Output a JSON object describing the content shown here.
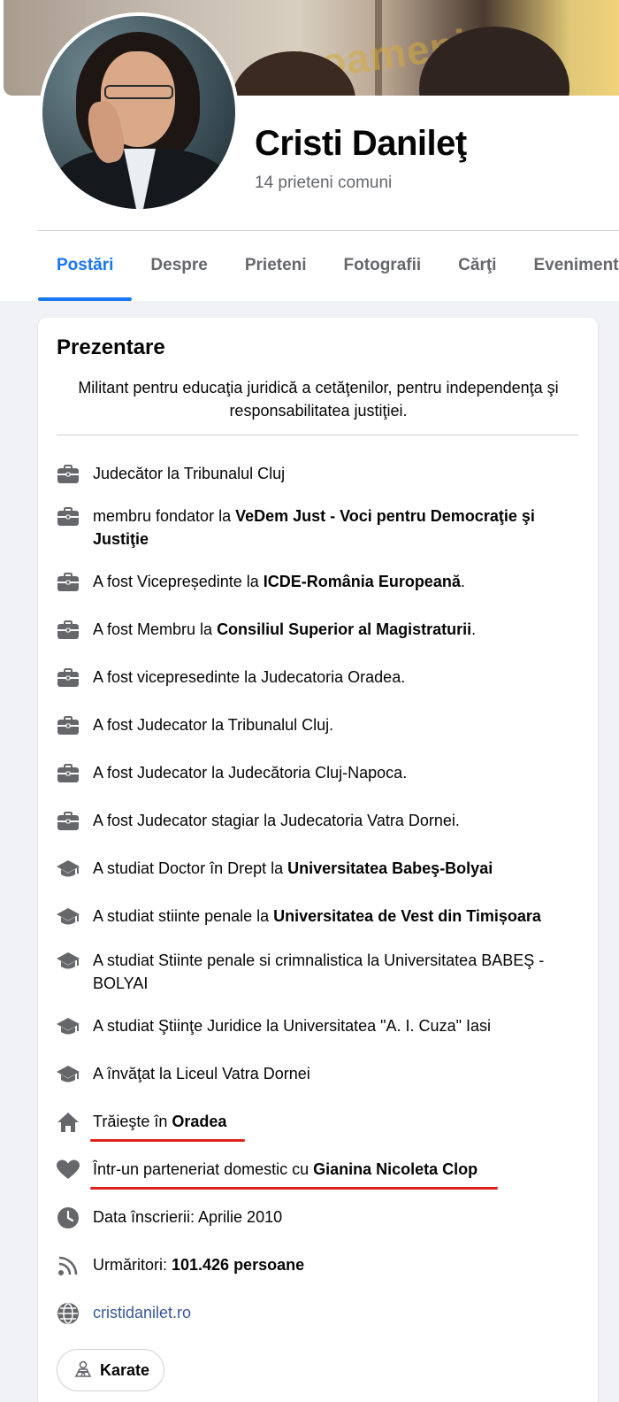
{
  "cover": {
    "banner_text": "ă oameni"
  },
  "profile": {
    "name": "Cristi Danileţ",
    "mutual_friends": "14 prieteni comuni"
  },
  "tabs": [
    {
      "label": "Postări"
    },
    {
      "label": "Despre"
    },
    {
      "label": "Prieteni"
    },
    {
      "label": "Fotografii"
    },
    {
      "label": "Cărţi"
    },
    {
      "label": "Evenimente"
    }
  ],
  "intro": {
    "title": "Prezentare",
    "bio": "Militant pentru educaţia juridică a cetăţenilor, pentru independenţa şi responsabilitatea justiţiei.",
    "items": [
      {
        "icon": "briefcase-icon",
        "pre": "Judecător la Tribunalul Cluj",
        "bold": "",
        "post": ""
      },
      {
        "icon": "briefcase-icon",
        "pre": "membru fondator la ",
        "bold": "VeDem Just - Voci pentru Democraţie şi Justiţie",
        "post": ""
      },
      {
        "icon": "briefcase-icon",
        "pre": "A fost Vicepreședinte la ",
        "bold": "ICDE-România Europeană",
        "post": "."
      },
      {
        "icon": "briefcase-icon",
        "pre": "A fost Membru la ",
        "bold": "Consiliul Superior al Magistraturii",
        "post": "."
      },
      {
        "icon": "briefcase-icon",
        "pre": "A fost vicepresedinte la Judecatoria Oradea.",
        "bold": "",
        "post": ""
      },
      {
        "icon": "briefcase-icon",
        "pre": "A fost Judecator la Tribunalul Cluj.",
        "bold": "",
        "post": ""
      },
      {
        "icon": "briefcase-icon",
        "pre": "A fost Judecator la Judecătoria Cluj-Napoca.",
        "bold": "",
        "post": ""
      },
      {
        "icon": "briefcase-icon",
        "pre": "A fost Judecator stagiar la Judecatoria Vatra Dornei.",
        "bold": "",
        "post": ""
      },
      {
        "icon": "graduation-cap-icon",
        "pre": "A studiat Doctor în Drept la ",
        "bold": "Universitatea Babeş-Bolyai",
        "post": ""
      },
      {
        "icon": "graduation-cap-icon",
        "pre": "A studiat stiinte penale la ",
        "bold": "Universitatea de Vest din Timișoara",
        "post": ""
      },
      {
        "icon": "graduation-cap-icon",
        "pre": "A studiat Stiinte penale si crimnalistica la Universitatea BABEŞ - BOLYAI",
        "bold": "",
        "post": ""
      },
      {
        "icon": "graduation-cap-icon",
        "pre": "A studiat Ştiinţe Juridice la Universitatea \"A. I. Cuza\" Iasi",
        "bold": "",
        "post": ""
      },
      {
        "icon": "graduation-cap-icon",
        "pre": "A învăţat la Liceul Vatra Dornei",
        "bold": "",
        "post": ""
      },
      {
        "icon": "home-icon",
        "pre": "Trăieşte în ",
        "bold": "Oradea",
        "post": ""
      },
      {
        "icon": "heart-icon",
        "pre": "Într-un parteneriat domestic cu ",
        "bold": "Gianina Nicoleta Clop",
        "post": ""
      },
      {
        "icon": "clock-icon",
        "pre": "Data înscrierii: Aprilie 2010",
        "bold": "",
        "post": ""
      },
      {
        "icon": "rss-icon",
        "pre": "Urmăritori: ",
        "bold": "101.426 persoane",
        "post": ""
      },
      {
        "icon": "globe-icon",
        "link": "cristidanilet.ro"
      }
    ],
    "hobby": {
      "icon": "karate-icon",
      "label": "Karate"
    }
  },
  "colors": {
    "accent": "#1877f2",
    "underline": "#e0201c",
    "muted": "#65676b",
    "icon": "#65676b"
  }
}
